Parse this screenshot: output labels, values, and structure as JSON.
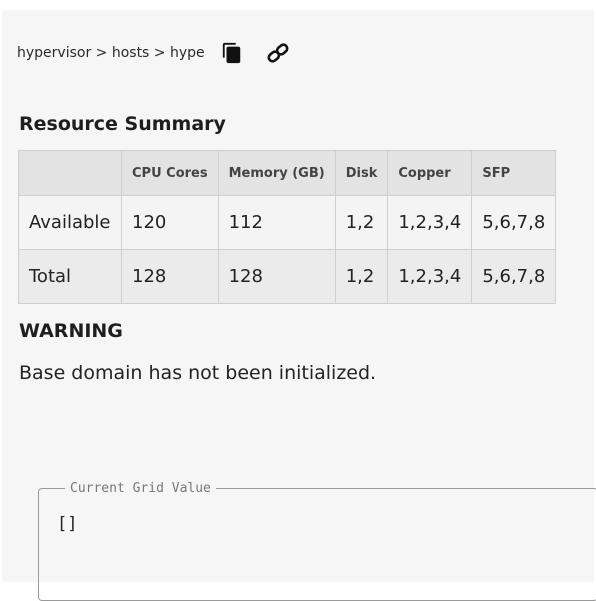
{
  "breadcrumb": {
    "text": "hypervisor > hosts > hype",
    "copy_icon": "copy-icon",
    "link_icon": "link-icon"
  },
  "resource_summary": {
    "title": "Resource Summary",
    "columns": [
      "",
      "CPU Cores",
      "Memory (GB)",
      "Disk",
      "Copper",
      "SFP"
    ],
    "rows": [
      {
        "label": "Available",
        "cpu": "120",
        "memory": "112",
        "disk": "1,2",
        "copper": "1,2,3,4",
        "sfp": "5,6,7,8"
      },
      {
        "label": "Total",
        "cpu": "128",
        "memory": "128",
        "disk": "1,2",
        "copper": "1,2,3,4",
        "sfp": "5,6,7,8"
      }
    ]
  },
  "warning": {
    "title": "WARNING",
    "message": "Base domain has not been initialized."
  },
  "grid_value": {
    "legend": "Current Grid Value",
    "content": "[]"
  },
  "colors": {
    "panel_background": "#f6f6f6",
    "header_background": "#e3e3e3",
    "border": "#cfcfcf"
  }
}
